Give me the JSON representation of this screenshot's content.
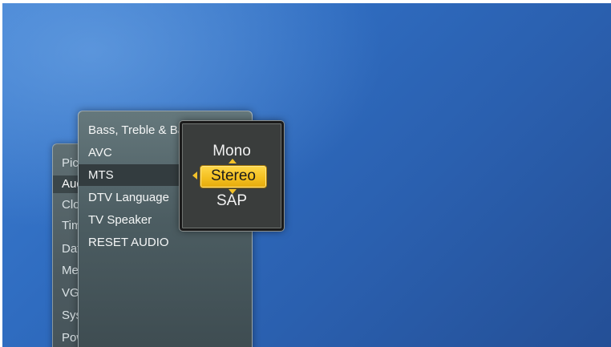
{
  "main_menu": {
    "items": [
      {
        "label": "Picture"
      },
      {
        "label": "Audio"
      },
      {
        "label": "Closed Caption"
      },
      {
        "label": "Timer"
      },
      {
        "label": "Date"
      },
      {
        "label": "Menu"
      },
      {
        "label": "VGA"
      },
      {
        "label": "System"
      },
      {
        "label": "Power"
      }
    ],
    "active_index": 1
  },
  "audio_menu": {
    "items": [
      {
        "label": "Bass, Treble & Balance"
      },
      {
        "label": "AVC"
      },
      {
        "label": "MTS"
      },
      {
        "label": "DTV Language"
      },
      {
        "label": "TV Speaker"
      },
      {
        "label": "RESET AUDIO"
      }
    ],
    "selected_index": 2
  },
  "mts_popup": {
    "option_above": "Mono",
    "selected": "Stereo",
    "option_below": "SAP"
  },
  "colors": {
    "background": "#2f6cc0",
    "highlight": "#f4c020",
    "panel": "#4c5d62"
  }
}
